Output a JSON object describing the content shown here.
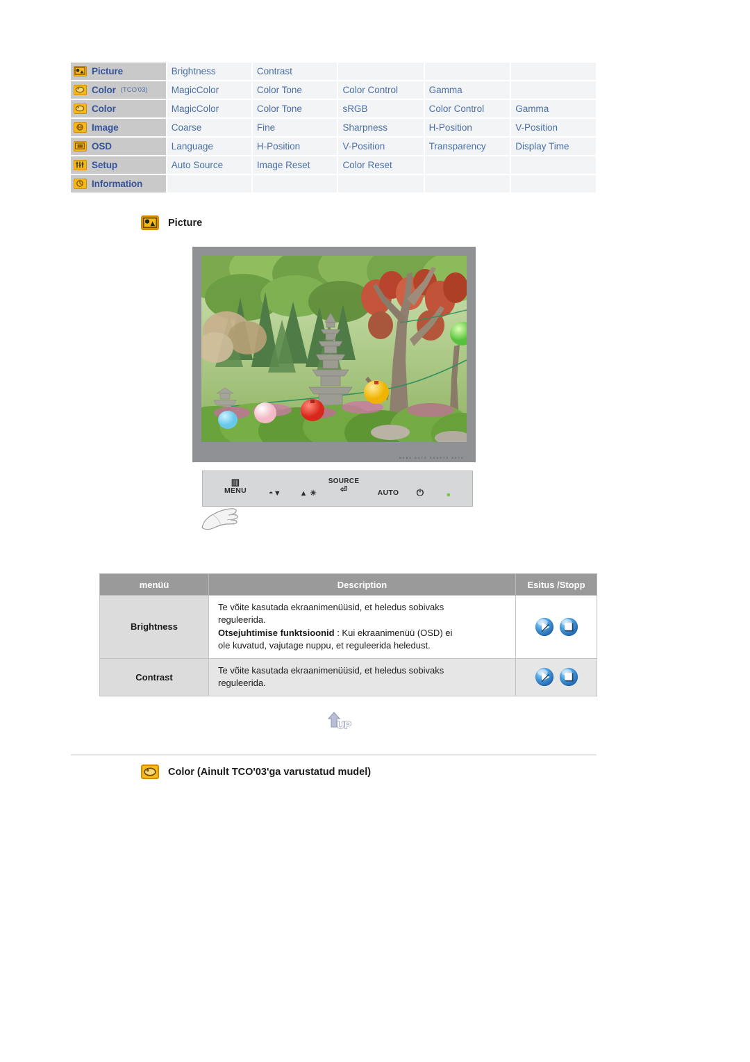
{
  "menu_map": {
    "rows": [
      {
        "icon": "picture-icon",
        "category": "Picture",
        "sub": "",
        "items": [
          "Brightness",
          "Contrast",
          "",
          "",
          ""
        ]
      },
      {
        "icon": "color-icon",
        "category": "Color",
        "sub": "(TCO'03)",
        "items": [
          "MagicColor",
          "Color Tone",
          "Color Control",
          "Gamma",
          ""
        ]
      },
      {
        "icon": "color-icon",
        "category": "Color",
        "sub": "",
        "items": [
          "MagicColor",
          "Color Tone",
          "sRGB",
          "Color Control",
          "Gamma"
        ]
      },
      {
        "icon": "image-icon",
        "category": "Image",
        "sub": "",
        "items": [
          "Coarse",
          "Fine",
          "Sharpness",
          "H-Position",
          "V-Position"
        ]
      },
      {
        "icon": "osd-icon",
        "category": "OSD",
        "sub": "",
        "items": [
          "Language",
          "H-Position",
          "V-Position",
          "Transparency",
          "Display Time"
        ]
      },
      {
        "icon": "setup-icon",
        "category": "Setup",
        "sub": "",
        "items": [
          "Auto Source",
          "Image Reset",
          "Color Reset",
          "",
          ""
        ]
      },
      {
        "icon": "information-icon",
        "category": "Information",
        "sub": "",
        "items": [
          "",
          "",
          "",
          "",
          ""
        ]
      }
    ]
  },
  "picture_section": {
    "heading": "Picture",
    "icon": "picture-icon"
  },
  "monitor": {
    "control_panel": {
      "menu_label": "MENU",
      "source_label": "SOURCE",
      "auto_label": "AUTO"
    },
    "bezel_text": "MENU  AUTO  SOURCE  AUTO"
  },
  "description_table": {
    "headers": {
      "menu": "menüü",
      "description": "Description",
      "control": "Esitus /Stopp"
    },
    "rows": [
      {
        "menu": "Brightness",
        "lines": [
          {
            "text": "Te võite kasutada ekraanimenüüsid, et heledus sobivaks",
            "bold": false
          },
          {
            "text": "reguleerida.",
            "bold": false
          }
        ],
        "bold_lead": "Otsejuhtimise funktsioonid",
        "bold_rest": " : Kui ekraanimenüü (OSD) ei",
        "tail": "ole kuvatud, vajutage nuppu, et reguleerida heledust."
      },
      {
        "menu": "Contrast",
        "lines": [
          {
            "text": "Te võite kasutada ekraanimenüüsid, et heledus sobivaks",
            "bold": false
          },
          {
            "text": "reguleerida.",
            "bold": false
          }
        ],
        "bold_lead": "",
        "bold_rest": "",
        "tail": ""
      }
    ],
    "control_icons": [
      "play-orb-icon",
      "stop-orb-icon"
    ]
  },
  "up_button": {
    "label": "UP",
    "icon": "up-arrow-icon"
  },
  "color_section": {
    "heading": "Color (Ainult TCO'03'ga varustatud mudel)",
    "icon": "color-icon"
  },
  "colors": {
    "menu_category_bg": "#c9c9c9",
    "menu_item_bg": "#f3f4f6",
    "menu_text": "#36549b",
    "menu_item_text": "#4a6fa5",
    "icon_fill": "#f5ba19",
    "icon_border": "#d68a00",
    "table_header_bg": "#9a9a9a",
    "orb_blue": "#3d8fd4"
  }
}
